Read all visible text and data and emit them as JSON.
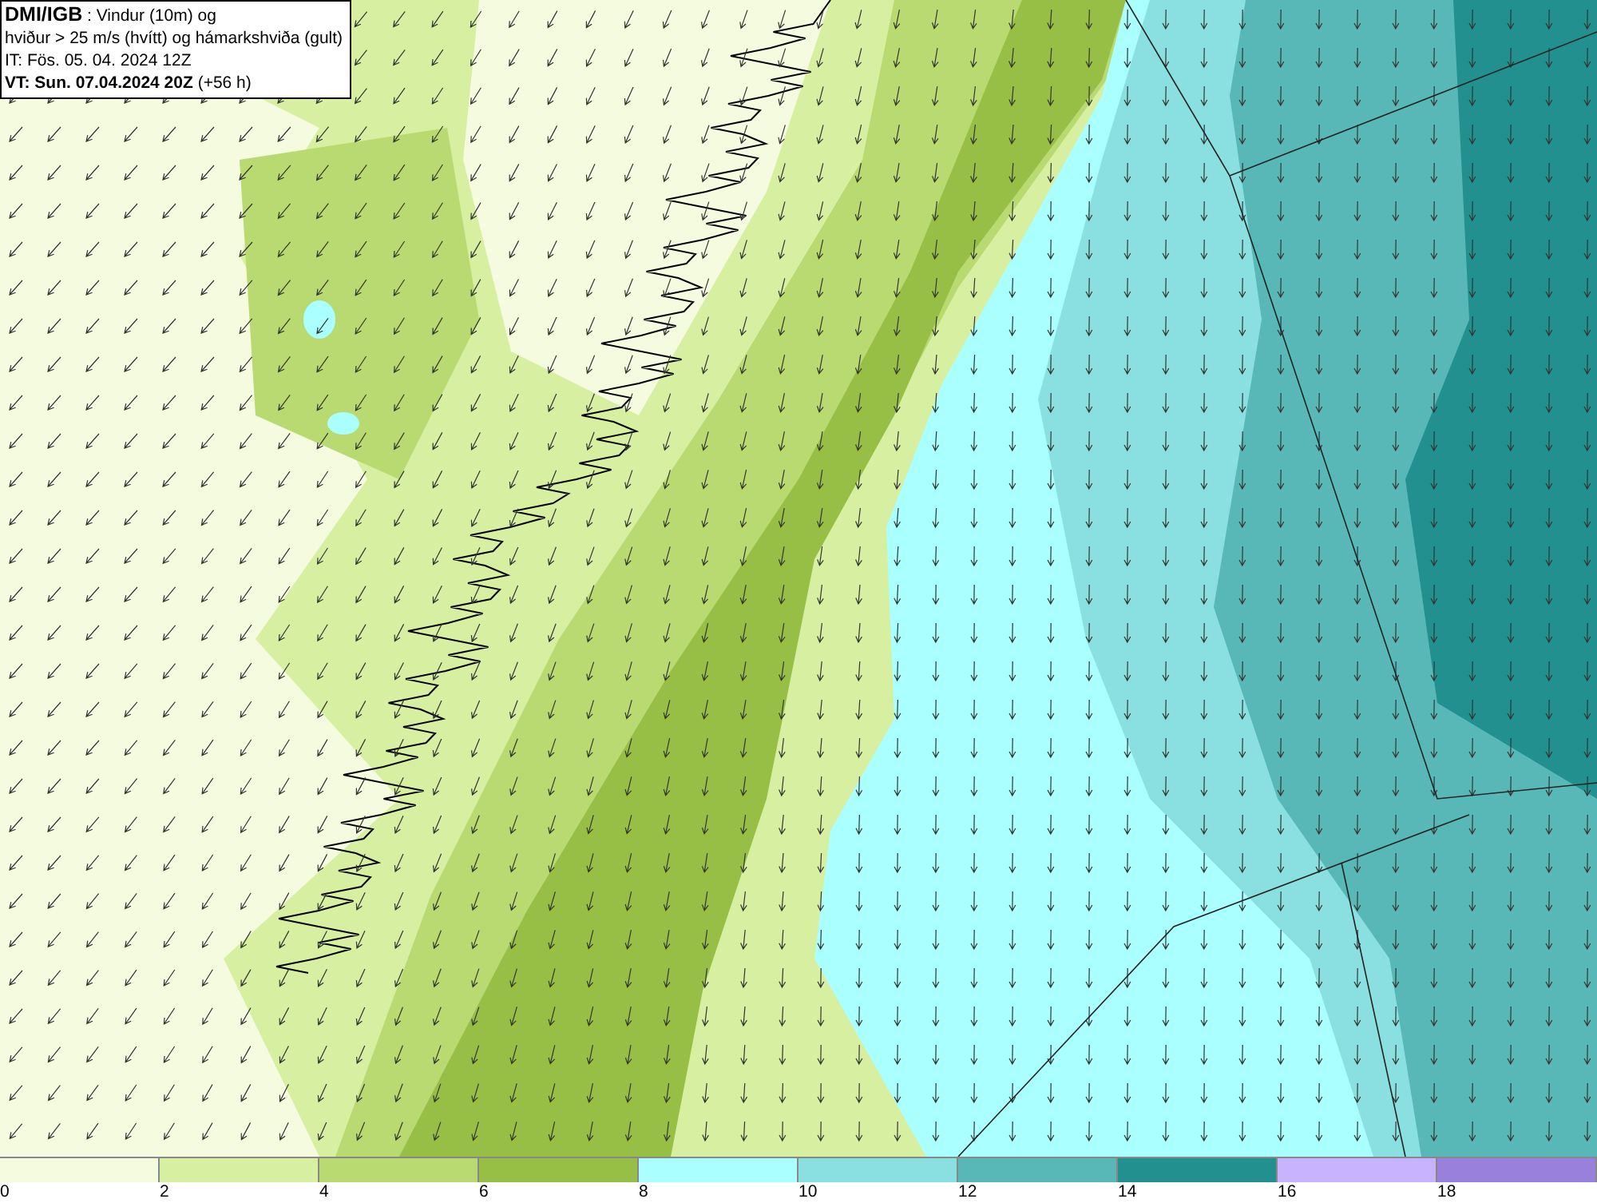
{
  "title_box": {
    "lines": [
      "**DMI/IGB** : Vindur (10m) og",
      "hviður > 25 m/s (hvítt) og hámarkshviða (gult)",
      "IT: Fös. 05. 04. 2024 12Z",
      "**VT: Sun. 07.04.2024 20Z** (+56 h)"
    ]
  },
  "legend": [
    {
      "label": "0",
      "color": "#f5fbdf"
    },
    {
      "label": "2",
      "color": "#d6efa0"
    },
    {
      "label": "4",
      "color": "#b8da70"
    },
    {
      "label": "6",
      "color": "#97bf45"
    },
    {
      "label": "8",
      "color": "#aaffff"
    },
    {
      "label": "10",
      "color": "#8ae0e0"
    },
    {
      "label": "12",
      "color": "#58b8b8"
    },
    {
      "label": "14",
      "color": "#239090"
    },
    {
      "label": "16",
      "color": "#c7b3ff"
    },
    {
      "label": "18",
      "color": "#9a80dd"
    }
  ]
}
